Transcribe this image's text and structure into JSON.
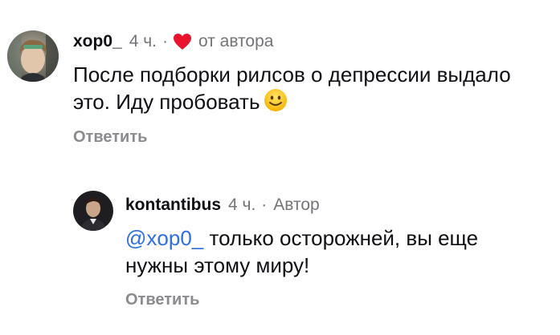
{
  "comments": [
    {
      "username": "xop0_",
      "time": "4 ч.",
      "separator": "·",
      "tag": "от автора",
      "text": "После подборки рилсов о депрессии выдало это. Иду пробовать",
      "reply_label": "Ответить",
      "liked_by_author": true
    },
    {
      "username": "kontantibus",
      "time": "4 ч.",
      "separator": "·",
      "tag": "Автор",
      "mention": "@xop0_",
      "text": " только осторожней, вы еще нужны этому миру!",
      "reply_label": "Ответить"
    }
  ],
  "colors": {
    "mention": "#2f6fe0",
    "heart": "#e8132f",
    "muted": "#737378"
  },
  "icons": {
    "heart": "heart-icon",
    "smiley": "smiley-emoji-icon"
  }
}
